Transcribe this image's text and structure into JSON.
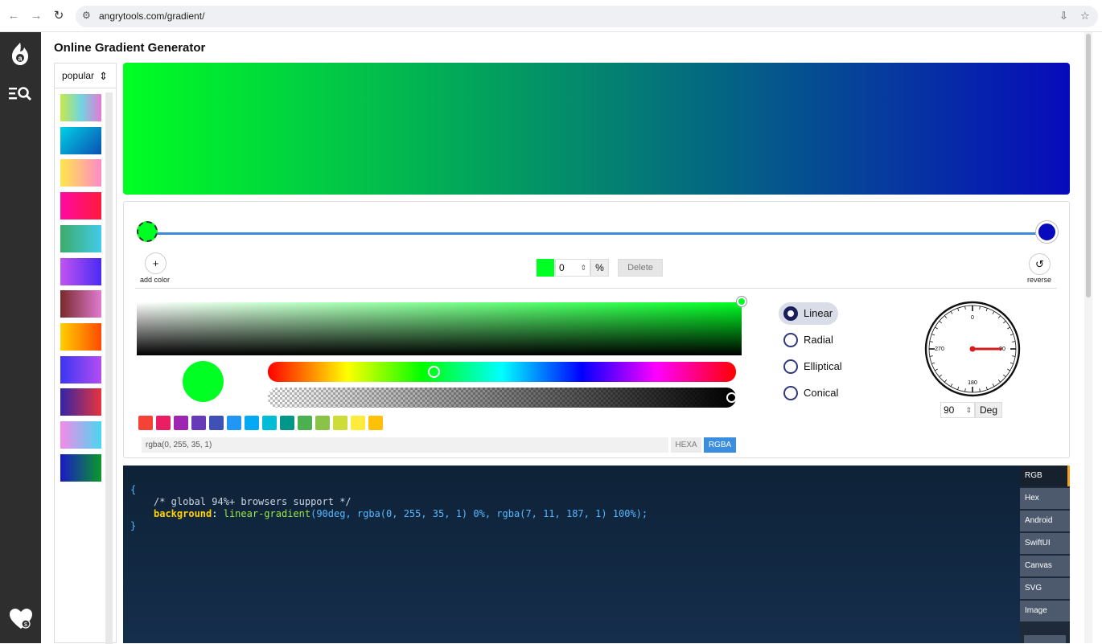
{
  "browser": {
    "url": "angrytools.com/gradient/",
    "back_glyph": "←",
    "forward_glyph": "→",
    "reload_glyph": "↻",
    "site_info_glyph": "⚙",
    "install_glyph": "⇩",
    "bookmark_glyph": "☆"
  },
  "page": {
    "title": "Online Gradient Generator"
  },
  "presets": {
    "selected": "popular",
    "arrows": "⇕",
    "swatches": [
      "linear-gradient(90deg,#c7e84a,#6fd6e0,#e27bd4)",
      "linear-gradient(135deg,#00d2e6,#0a4fb3)",
      "linear-gradient(90deg,#ffe64a,#ff8ac8)",
      "linear-gradient(90deg,#ff0aa0,#ff1a3c)",
      "linear-gradient(90deg,#3dab6a,#43cbe8)",
      "linear-gradient(90deg,#c054f0,#4a2bf5)",
      "linear-gradient(90deg,#7a2a2a,#e07ad2)",
      "linear-gradient(90deg,#ffd000,#ff4a00)",
      "linear-gradient(90deg,#3a36f2,#b34df2)",
      "linear-gradient(90deg,#3124a8,#e8333c)",
      "linear-gradient(90deg,#f58ae8,#4ad6f0)",
      "linear-gradient(90deg,#1a18c8,#0a9a2a)"
    ]
  },
  "gradient": {
    "css": "linear-gradient(90deg, rgba(0, 255, 35, 1) 0%, rgba(7, 11, 187, 1) 100%)",
    "angle": "90",
    "stops": [
      {
        "color": "rgba(0, 255, 35, 1)",
        "position": 0
      },
      {
        "color": "rgba(7, 11, 187, 1)",
        "position": 100
      }
    ]
  },
  "editor": {
    "add_color_icon": "+",
    "add_color_label": "add color",
    "reverse_icon": "↺",
    "reverse_label": "reverse",
    "stop_position": "0",
    "stop_spin": "⇕",
    "percent_label": "%",
    "delete_label": "Delete",
    "hue_fraction": 0.355,
    "alpha_fraction": 1.0,
    "palette": [
      "#f44336",
      "#e91e63",
      "#9c27b0",
      "#673ab7",
      "#3f51b5",
      "#2196f3",
      "#03a9f4",
      "#00bcd4",
      "#009688",
      "#4caf50",
      "#8bc34a",
      "#cddc39",
      "#ffeb3b",
      "#ffc107"
    ],
    "color_value": "rgba(0, 255, 35, 1)",
    "format_hexa": "HEXA",
    "format_rgba": "RGBA",
    "active_format": "RGBA"
  },
  "types": {
    "options": [
      "Linear",
      "Radial",
      "Elliptical",
      "Conical"
    ],
    "selected": "Linear"
  },
  "dial": {
    "labels": {
      "top": "0",
      "right": "90",
      "bottom": "180",
      "left": "270"
    },
    "angle_deg": 90,
    "degree_value": "90",
    "degree_spin": "⇕",
    "unit_label": "Deg"
  },
  "code": {
    "open_brace": "{",
    "comment": "/* global 94%+ browsers support */",
    "property": "background",
    "colon": ":",
    "func_name": "linear-gradient",
    "args": "(90deg, rgba(0, 255, 35, 1) 0%, rgba(7, 11, 187, 1) 100%);",
    "close_brace": "}"
  },
  "output_tabs": {
    "items": [
      "RGB",
      "Hex",
      "Android",
      "SwiftUI",
      "Canvas",
      "SVG",
      "Image"
    ],
    "selected": "RGB"
  },
  "colors": {
    "accent_blue": "#3d8bd8",
    "tab_highlight": "#f2a51a",
    "code_yellow": "#ffd400",
    "code_green": "#9be84a",
    "code_blue": "#55b8ff",
    "code_comment": "#c9d4e2",
    "rgba_button": "#3b8de0"
  }
}
